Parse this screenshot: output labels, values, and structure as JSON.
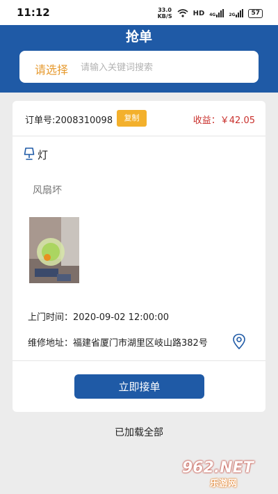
{
  "status_bar": {
    "time": "11:12",
    "speed_value": "33.0",
    "speed_unit": "KB/S",
    "network_hd": "HD",
    "network_4g": "4G",
    "network_2g": "2G",
    "battery": "57"
  },
  "header": {
    "title": "抢单"
  },
  "search": {
    "select_label": "请选择",
    "placeholder": "请输入关键词搜索"
  },
  "order": {
    "order_no": "订单号:2008310098",
    "copy_label": "复制",
    "earning": "收益：￥42.05",
    "category": "灯",
    "fault": "风扇坏",
    "visit_time": "上门时间：2020-09-02 12:00:00",
    "address": "维修地址：福建省厦门市湖里区岐山路382号",
    "accept_label": "立即接单"
  },
  "footer": {
    "loaded_text": "已加载全部"
  },
  "watermark": {
    "top": "962.NET",
    "bottom": "乐游网"
  },
  "colors": {
    "brand_blue": "#1f5aa6",
    "accent_orange": "#f3b02c",
    "earning_red": "#c9302c"
  }
}
